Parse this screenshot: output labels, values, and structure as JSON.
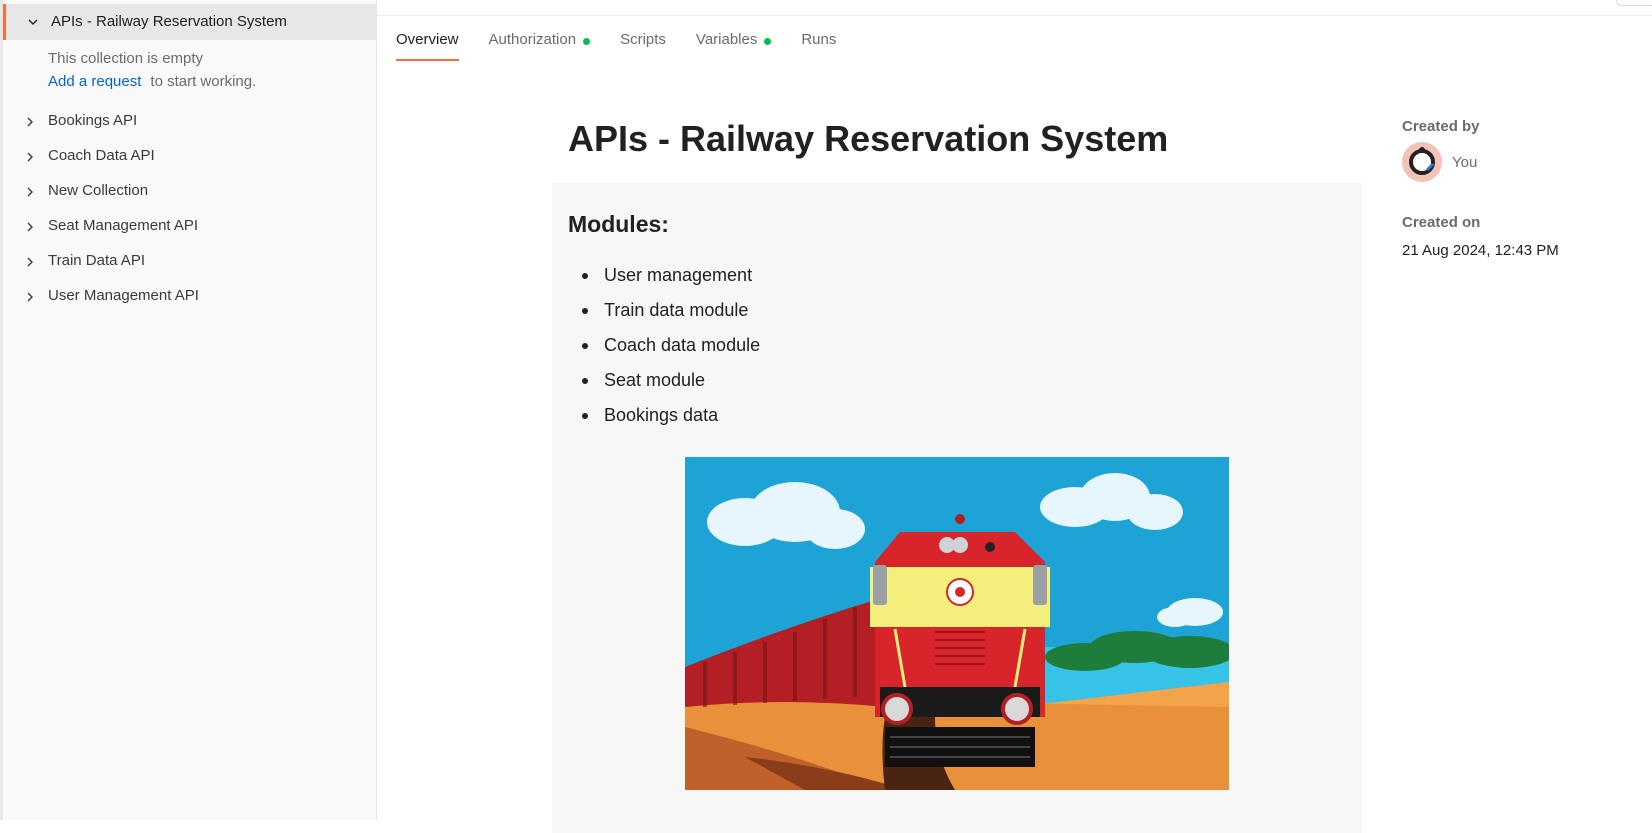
{
  "sidebar": {
    "active_collection": {
      "label": "APIs - Railway Reservation System",
      "empty_message": "This collection is empty",
      "add_request_link": "Add a request",
      "empty_hint_suffix": "to start working."
    },
    "items": [
      {
        "label": "Bookings API"
      },
      {
        "label": "Coach Data API"
      },
      {
        "label": "New Collection"
      },
      {
        "label": "Seat Management API"
      },
      {
        "label": "Train Data API"
      },
      {
        "label": "User Management API"
      }
    ]
  },
  "tabs": [
    {
      "label": "Overview",
      "active": true,
      "status_dot": false
    },
    {
      "label": "Authorization",
      "active": false,
      "status_dot": true
    },
    {
      "label": "Scripts",
      "active": false,
      "status_dot": false
    },
    {
      "label": "Variables",
      "active": false,
      "status_dot": true
    },
    {
      "label": "Runs",
      "active": false,
      "status_dot": false
    }
  ],
  "main": {
    "title": "APIs - Railway Reservation System",
    "modules_heading": "Modules:",
    "modules": [
      "User management",
      "Train data module",
      "Coach data module",
      "Seat module",
      "Bookings data"
    ]
  },
  "meta": {
    "created_by_label": "Created by",
    "created_by_name": "You",
    "created_on_label": "Created on",
    "created_on_value": "21 Aug 2024, 12:43 PM"
  },
  "colors": {
    "accent": "#ff6c37",
    "link": "#0265d2",
    "status_dot": "#0cbb52"
  }
}
